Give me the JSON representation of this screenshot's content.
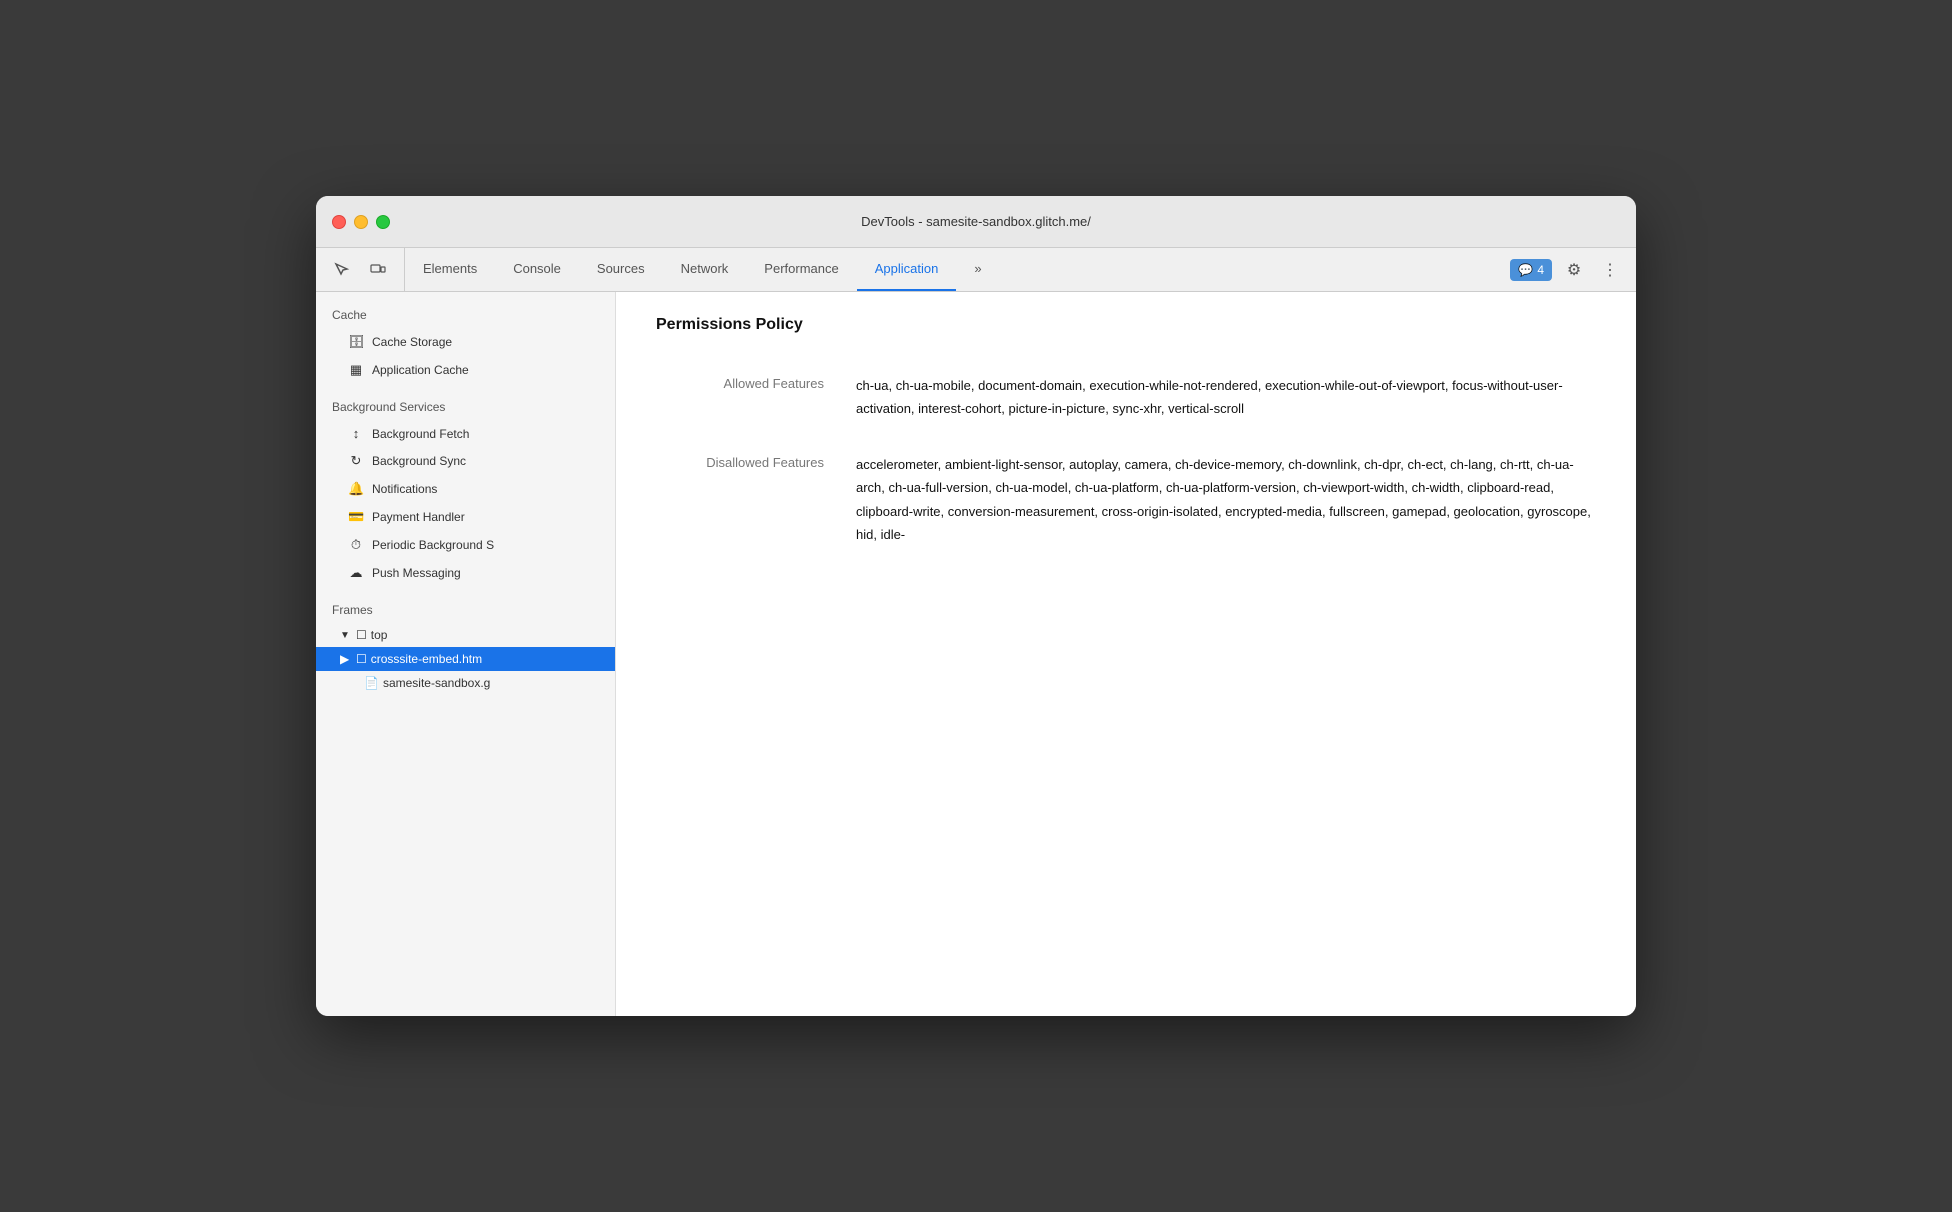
{
  "window": {
    "title": "DevTools - samesite-sandbox.glitch.me/"
  },
  "toolbar": {
    "tabs": [
      {
        "id": "elements",
        "label": "Elements",
        "active": false
      },
      {
        "id": "console",
        "label": "Console",
        "active": false
      },
      {
        "id": "sources",
        "label": "Sources",
        "active": false
      },
      {
        "id": "network",
        "label": "Network",
        "active": false
      },
      {
        "id": "performance",
        "label": "Performance",
        "active": false
      },
      {
        "id": "application",
        "label": "Application",
        "active": true
      }
    ],
    "more_tabs_label": "»",
    "badge_count": "4",
    "badge_icon": "💬"
  },
  "sidebar": {
    "cache_section": "Cache",
    "cache_storage_label": "Cache Storage",
    "application_cache_label": "Application Cache",
    "background_services_section": "Background Services",
    "background_fetch_label": "Background Fetch",
    "background_sync_label": "Background Sync",
    "notifications_label": "Notifications",
    "payment_handler_label": "Payment Handler",
    "periodic_background_label": "Periodic Background S",
    "push_messaging_label": "Push Messaging",
    "frames_section": "Frames",
    "top_label": "top",
    "frame_active_label": "crosssite-embed.htm",
    "frame_sub_label": "samesite-sandbox.g"
  },
  "content": {
    "title": "Permissions Policy",
    "allowed_features_label": "Allowed Features",
    "allowed_features_value": "ch-ua, ch-ua-mobile, document-domain, execution-while-not-rendered, execution-while-out-of-viewport, focus-without-user-activation, interest-cohort, picture-in-picture, sync-xhr, vertical-scroll",
    "disallowed_features_label": "Disallowed Features",
    "disallowed_features_value": "accelerometer, ambient-light-sensor, autoplay, camera, ch-device-memory, ch-downlink, ch-dpr, ch-ect, ch-lang, ch-rtt, ch-ua-arch, ch-ua-full-version, ch-ua-model, ch-ua-platform, ch-ua-platform-version, ch-viewport-width, ch-width, clipboard-read, clipboard-write, conversion-measurement, cross-origin-isolated, encrypted-media, fullscreen, gamepad, geolocation, gyroscope, hid, idle-"
  }
}
